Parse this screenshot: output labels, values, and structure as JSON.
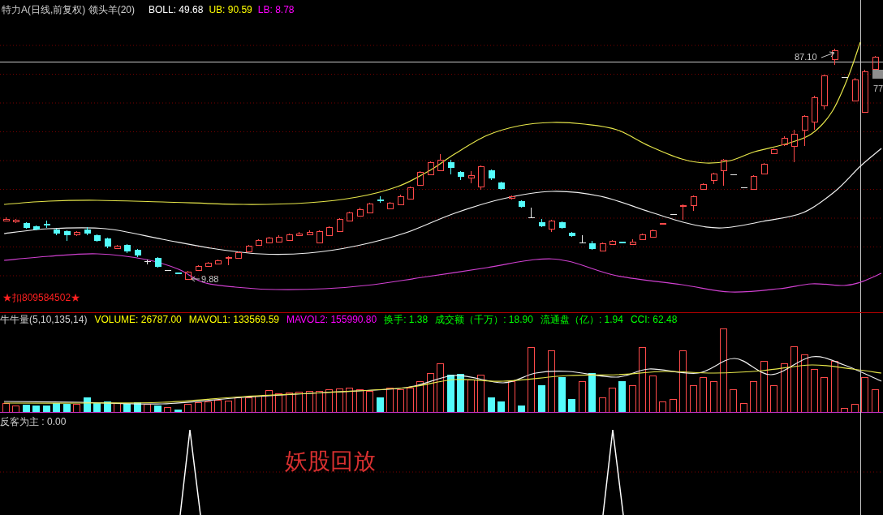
{
  "price_panel": {
    "title": "特力A(日线,前复权) 领头羊(20)",
    "indicators": [
      {
        "label": "BOLL: 49.68",
        "color": "#ffffff"
      },
      {
        "label": "UB: 90.59",
        "color": "#ffff00"
      },
      {
        "label": "LB: 8.78",
        "color": "#ff00ff"
      }
    ],
    "high_label": "87.10",
    "low_label": "9.88",
    "edge_label": "77",
    "contact_text": "★扣809584502★"
  },
  "volume_panel": {
    "title": "牛牛量(5,10,135,14)",
    "indicators": [
      {
        "label": "VOLUME: 26787.00",
        "color": "#ffff00"
      },
      {
        "label": "MAVOL1: 133569.59",
        "color": "#ffff00"
      },
      {
        "label": "MAVOL2: 155990.80",
        "color": "#ff00ff"
      },
      {
        "label": "换手: 1.38",
        "color": "#00ff00"
      },
      {
        "label": "成交额（千万）: 18.90",
        "color": "#00ff00"
      },
      {
        "label": "流通盘（亿）: 1.94",
        "color": "#00ff00"
      },
      {
        "label": "CCI: 62.48",
        "color": "#00ff00"
      }
    ]
  },
  "signal_panel": {
    "title": "反客为主 : 0.00",
    "caption": "妖股回放"
  }
}
